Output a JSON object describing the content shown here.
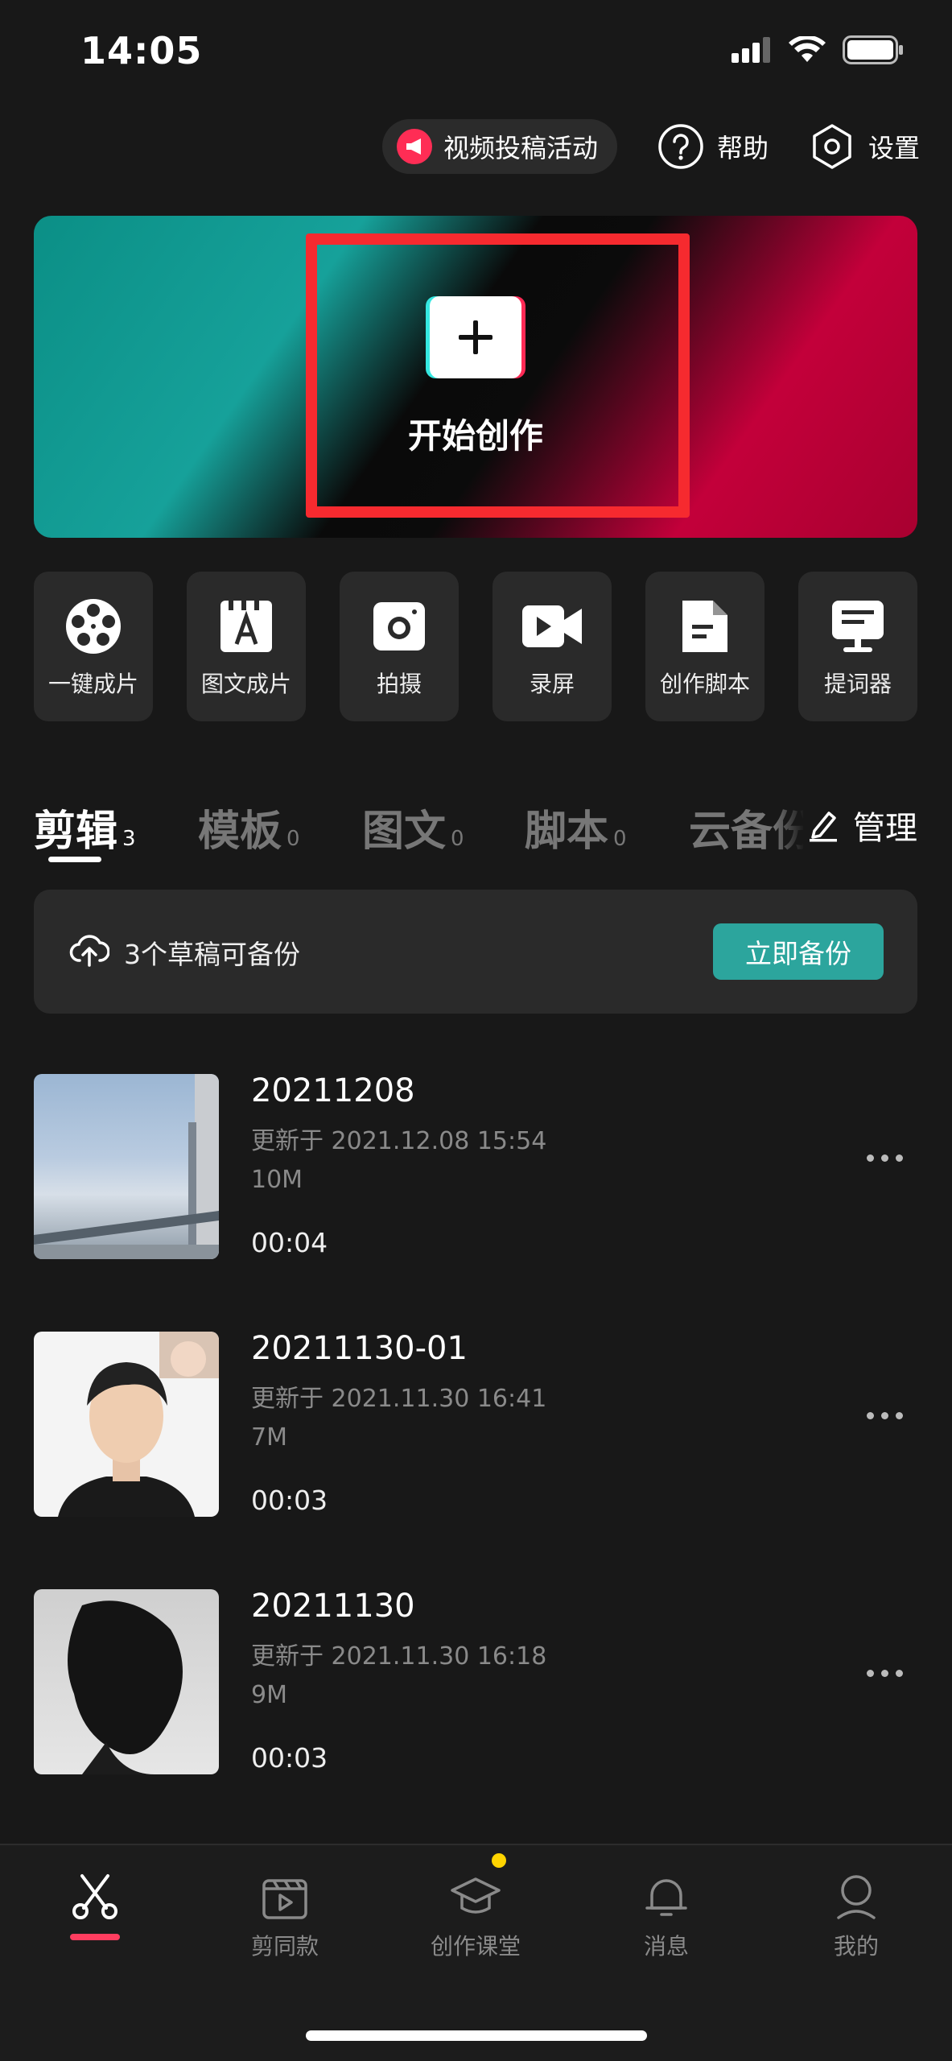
{
  "status_bar": {
    "time": "14:05"
  },
  "top_actions": {
    "campaign": "视频投稿活动",
    "help": "帮助",
    "settings": "设置"
  },
  "hero": {
    "label": "开始创作"
  },
  "tools": [
    {
      "label": "一键成片",
      "icon": "film-reel-icon"
    },
    {
      "label": "图文成片",
      "icon": "text-to-video-icon"
    },
    {
      "label": "拍摄",
      "icon": "camera-icon"
    },
    {
      "label": "录屏",
      "icon": "screen-record-icon"
    },
    {
      "label": "创作脚本",
      "icon": "script-document-icon"
    },
    {
      "label": "提词器",
      "icon": "teleprompter-icon"
    }
  ],
  "tabs": [
    {
      "label": "剪辑",
      "count": "3"
    },
    {
      "label": "模板",
      "count": "0"
    },
    {
      "label": "图文",
      "count": "0"
    },
    {
      "label": "脚本",
      "count": "0"
    },
    {
      "label": "云备份",
      "count": ""
    }
  ],
  "manage_label": "管理",
  "backup": {
    "text": "3个草稿可备份",
    "button": "立即备份"
  },
  "drafts": [
    {
      "title": "20211208",
      "updated": "更新于 2021.12.08 15:54",
      "size": "10M",
      "duration": "00:04"
    },
    {
      "title": "20211130-01",
      "updated": "更新于 2021.11.30 16:41",
      "size": "7M",
      "duration": "00:03"
    },
    {
      "title": "20211130",
      "updated": "更新于 2021.11.30 16:18",
      "size": "9M",
      "duration": "00:03"
    }
  ],
  "nav": [
    {
      "label": "",
      "icon": "scissors-icon"
    },
    {
      "label": "剪同款",
      "icon": "template-clapper-icon"
    },
    {
      "label": "创作课堂",
      "icon": "graduation-cap-icon"
    },
    {
      "label": "消息",
      "icon": "bell-icon"
    },
    {
      "label": "我的",
      "icon": "profile-icon"
    }
  ],
  "colors": {
    "accent": "#2ca59d",
    "active_nav": "#ff3d5f",
    "highlight_frame": "#f62a2f"
  }
}
